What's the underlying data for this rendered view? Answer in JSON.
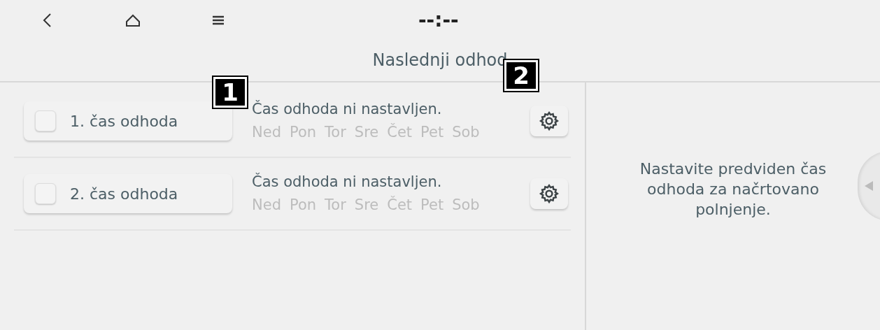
{
  "top_bar": {
    "clock": "--:--"
  },
  "title": "Naslednji odhod",
  "departures": [
    {
      "label": "1. čas odhoda",
      "checked": false,
      "status": "Čas odhoda ni nastavljen.",
      "days": [
        "Ned",
        "Pon",
        "Tor",
        "Sre",
        "Čet",
        "Pet",
        "Sob"
      ]
    },
    {
      "label": "2. čas odhoda",
      "checked": false,
      "status": "Čas odhoda ni nastavljen.",
      "days": [
        "Ned",
        "Pon",
        "Tor",
        "Sre",
        "Čet",
        "Pet",
        "Sob"
      ]
    }
  ],
  "info_text": "Nastavite predviden čas odhoda za načrtovano polnjenje.",
  "callouts": [
    "1",
    "2"
  ]
}
